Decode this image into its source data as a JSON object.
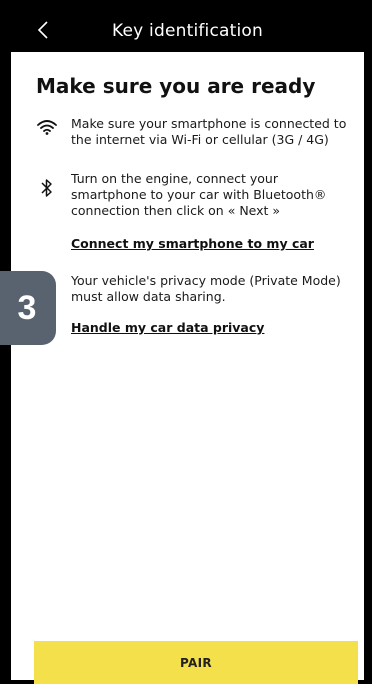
{
  "header": {
    "title": "Key identification",
    "back_icon": "chevron-left-icon"
  },
  "main": {
    "heading": "Make sure you are ready",
    "items": [
      {
        "icon": "wifi-icon",
        "text": "Make sure your smartphone is connected to the internet via Wi-Fi or cellular (3G / 4G)"
      },
      {
        "icon": "bluetooth-icon",
        "text": "Turn on the engine, connect your smartphone to your car with Bluetooth® connection then click on « Next »"
      },
      {
        "icon": "shield-icon",
        "text": "Your vehicle's privacy mode (Private Mode) must allow data sharing."
      }
    ],
    "links": {
      "connect": "Connect my smartphone to my car",
      "privacy": "Handle my car data privacy"
    }
  },
  "step_badge": "3",
  "footer": {
    "pair_label": "PAIR"
  },
  "colors": {
    "accent": "#f4e04a",
    "topbar": "#000000",
    "badge": "#59636f"
  }
}
